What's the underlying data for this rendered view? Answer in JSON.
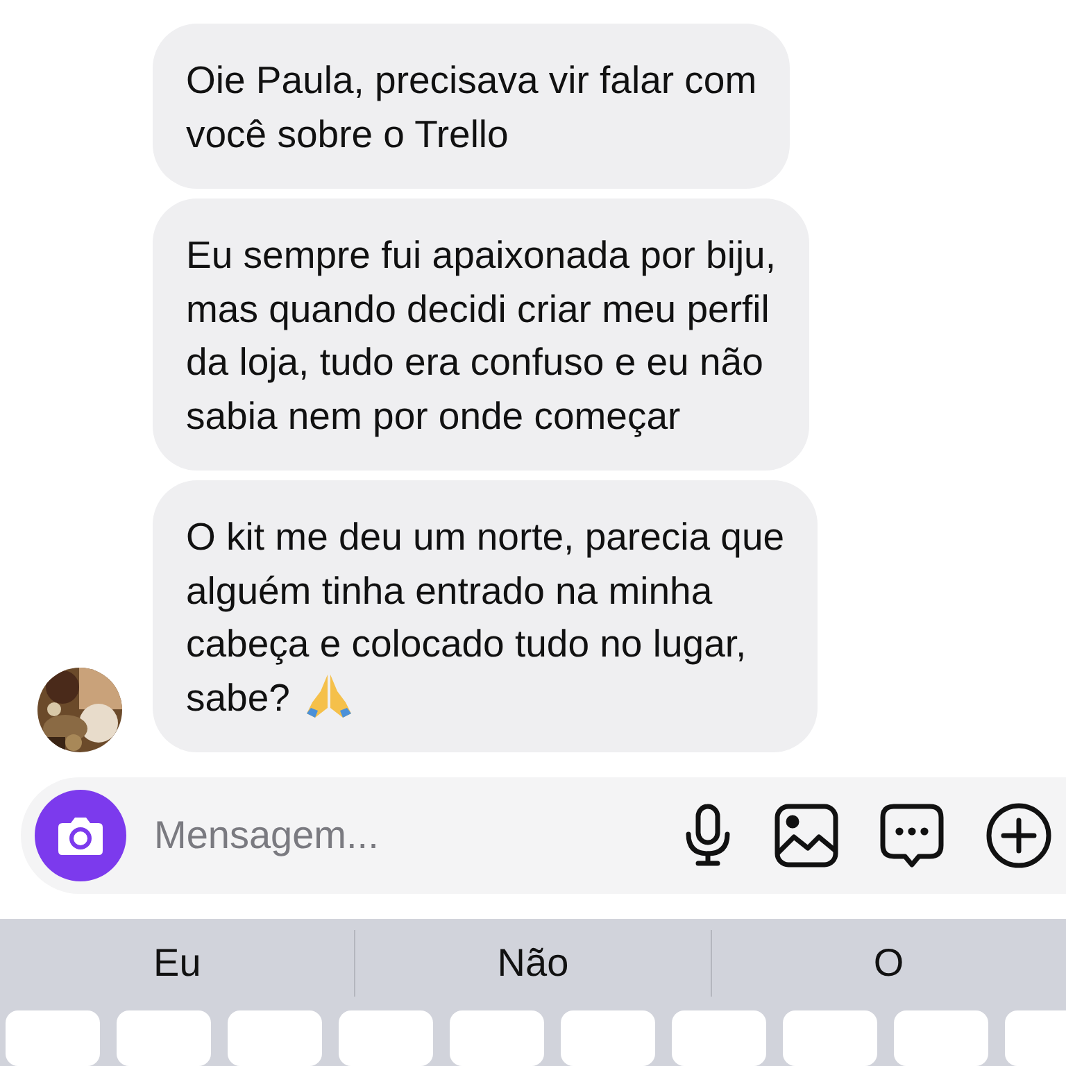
{
  "messages": [
    {
      "lines": [
        "Oie Paula, precisava vir falar com",
        "você sobre o Trello"
      ],
      "reaction_icon": false
    },
    {
      "lines": [
        "Eu sempre fui apaixonada por biju,",
        "mas quando decidi criar meu perfil",
        "da loja, tudo era confuso e eu não",
        "sabia nem por onde começar"
      ],
      "reaction_icon": false
    },
    {
      "lines": [
        "O kit me deu um norte, parecia que",
        "alguém tinha entrado na minha",
        "cabeça e colocado tudo no lugar,",
        "sabe?"
      ],
      "reaction_icon": true
    }
  ],
  "composer": {
    "placeholder": "Mensagem..."
  },
  "suggestions": [
    "Eu",
    "Não",
    "O"
  ]
}
